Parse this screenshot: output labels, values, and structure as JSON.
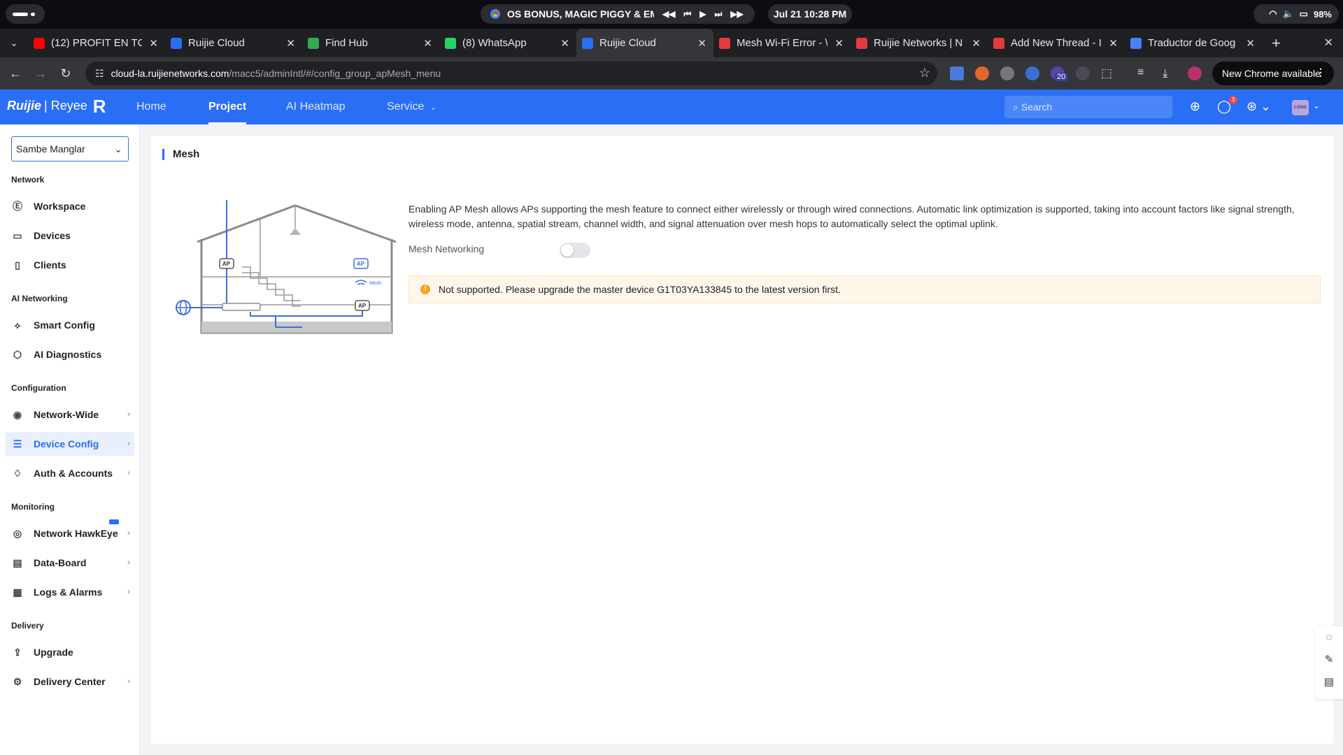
{
  "os": {
    "media_title": "OS BONUS, MAGIC PIGGY & EMI",
    "clock": "Jul 21  10:28 PM",
    "battery": "98%"
  },
  "tabs": [
    {
      "title": "(12) PROFIT EN TC",
      "favicon": "youtube-icon",
      "color": "#ff0000"
    },
    {
      "title": "Ruijie Cloud",
      "favicon": "ruijie-cloud-icon",
      "color": "#2a6ef5"
    },
    {
      "title": "Find Hub",
      "favicon": "find-hub-icon",
      "color": "#34a853"
    },
    {
      "title": "(8) WhatsApp",
      "favicon": "whatsapp-icon",
      "color": "#25d366"
    },
    {
      "title": "Ruijie Cloud",
      "favicon": "ruijie-cloud-icon",
      "color": "#2a6ef5",
      "active": true
    },
    {
      "title": "Mesh Wi-Fi Error - \\",
      "favicon": "ruijie-icon",
      "color": "#e23b3b"
    },
    {
      "title": "Ruijie Networks | N",
      "favicon": "ruijie-icon",
      "color": "#e23b3b"
    },
    {
      "title": "Add New Thread - I",
      "favicon": "ruijie-icon",
      "color": "#e23b3b"
    },
    {
      "title": "Traductor de Goog",
      "favicon": "google-translate-icon",
      "color": "#4285f4"
    }
  ],
  "browser": {
    "url_host": "cloud-la.ruijienetworks.com",
    "url_path": "/macc5/adminIntl/#/config_group_apMesh_menu",
    "extension_badge": "20",
    "update_label": "New Chrome available"
  },
  "header": {
    "brand": "Ruijie",
    "brand_sub": "| Reyee",
    "brand_mark": "R",
    "nav": {
      "home": "Home",
      "project": "Project",
      "heatmap": "AI Heatmap",
      "service": "Service"
    },
    "search_placeholder": "Search",
    "notification_count": "3",
    "avatar_text": "LOGO"
  },
  "sidebar": {
    "project": "Sambe Manglar",
    "sections": {
      "network": "Network",
      "ai_networking": "AI Networking",
      "configuration": "Configuration",
      "monitoring": "Monitoring",
      "delivery": "Delivery"
    },
    "items": {
      "workspace": "Workspace",
      "devices": "Devices",
      "clients": "Clients",
      "smart_config": "Smart Config",
      "ai_diagnostics": "AI Diagnostics",
      "network_wide": "Network-Wide",
      "device_config": "Device Config",
      "auth_accounts": "Auth & Accounts",
      "network_hawkeye": "Network HawkEye",
      "data_board": "Data-Board",
      "logs_alarms": "Logs & Alarms",
      "upgrade": "Upgrade",
      "delivery_center": "Delivery Center"
    }
  },
  "main": {
    "title": "Mesh",
    "description": "Enabling AP Mesh allows APs supporting the mesh feature to connect either wirelessly or through wired connections. Automatic link optimization is supported, taking into account factors like signal strength, wireless mode, antenna, spatial stream, channel width, and signal attenuation over mesh hops to automatically select the optimal uplink.",
    "mesh_networking_label": "Mesh Networking",
    "mesh_networking_enabled": false,
    "alert": "Not supported. Please upgrade the master device G1T03YA133845 to the latest version first.",
    "illustration": {
      "ap_label": "AP",
      "mesh_label": "Mesh"
    }
  },
  "colors": {
    "accent": "#2a6ef5",
    "warning": "#f5a623",
    "alert_bg": "#fff6ea"
  }
}
